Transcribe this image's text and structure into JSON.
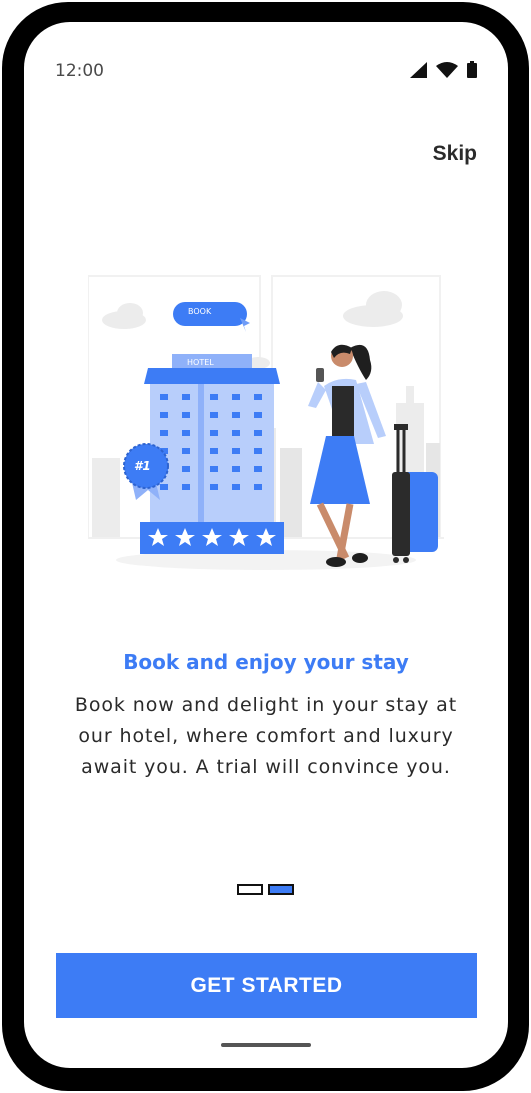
{
  "status_bar": {
    "time": "12:00",
    "icons": [
      "cellular-signal-icon",
      "wifi-icon",
      "battery-icon"
    ]
  },
  "header": {
    "skip_label": "Skip"
  },
  "illustration": {
    "book_label": "BOOK",
    "hotel_label": "HOTEL",
    "badge_label": "#1",
    "stars": 5
  },
  "onboarding": {
    "title": "Book and enjoy your stay",
    "description": "Book now and delight in your stay at our hotel, where comfort and luxury await you. A trial will convince you."
  },
  "pager": {
    "total": 2,
    "current": 2
  },
  "footer": {
    "cta_label": "GET STARTED"
  },
  "colors": {
    "accent": "#3d7cf5",
    "frame": "#000000",
    "text": "#2a2a2a"
  }
}
